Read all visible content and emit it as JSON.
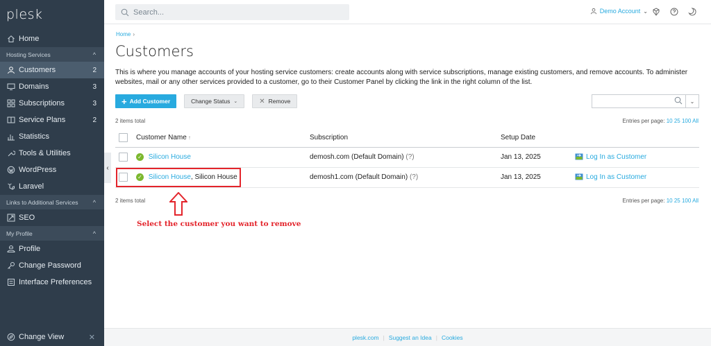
{
  "sidebar": {
    "logo": "plesk",
    "items": {
      "home": {
        "label": "Home"
      },
      "customers": {
        "label": "Customers",
        "count": "2"
      },
      "domains": {
        "label": "Domains",
        "count": "3"
      },
      "subscriptions": {
        "label": "Subscriptions",
        "count": "3"
      },
      "service_plans": {
        "label": "Service Plans",
        "count": "2"
      },
      "statistics": {
        "label": "Statistics"
      },
      "tools": {
        "label": "Tools & Utilities"
      },
      "wordpress": {
        "label": "WordPress"
      },
      "laravel": {
        "label": "Laravel"
      },
      "seo": {
        "label": "SEO"
      },
      "profile": {
        "label": "Profile"
      },
      "change_password": {
        "label": "Change Password"
      },
      "interface_prefs": {
        "label": "Interface Preferences"
      }
    },
    "sections": {
      "hosting": "Hosting Services",
      "links": "Links to Additional Services",
      "my_profile": "My Profile"
    },
    "change_view": "Change View"
  },
  "topbar": {
    "search_placeholder": "Search...",
    "account": "Demo Account"
  },
  "main": {
    "breadcrumb": "Home",
    "title": "Customers",
    "description": "This is where you manage accounts of your hosting service customers: create accounts along with service subscriptions, manage existing customers, and remove accounts. To administer websites, mail or any other services provided to a customer, go to their Customer Panel by clicking the link in the right column of the list.",
    "toolbar": {
      "add": "Add Customer",
      "change_status": "Change Status",
      "remove": "Remove"
    },
    "items_total": "2 items total",
    "entries_label": "Entries per page:",
    "entries_options": [
      "10",
      "25",
      "100",
      "All"
    ],
    "table": {
      "headers": {
        "name": "Customer Name",
        "subscription": "Subscription",
        "setup_date": "Setup Date"
      },
      "rows": [
        {
          "name": "Silicon House",
          "company": "",
          "subscription": "demosh.com (Default Domain)",
          "hint": "(?)",
          "date": "Jan 13, 2025",
          "login": "Log In as Customer"
        },
        {
          "name": "Silicon House",
          "company": ", Silicon House",
          "subscription": "demosh1.com (Default Domain)",
          "hint": "(?)",
          "date": "Jan 13, 2025",
          "login": "Log In as Customer"
        }
      ]
    },
    "annotation": "Select the customer you want to remove"
  },
  "footer": {
    "links": [
      "plesk.com",
      "Suggest an Idea",
      "Cookies"
    ]
  },
  "colors": {
    "sidebar_bg": "#2f3d4b",
    "accent": "#28aadf",
    "annotation_red": "#e3242b",
    "status_ok": "#7cb82f"
  }
}
